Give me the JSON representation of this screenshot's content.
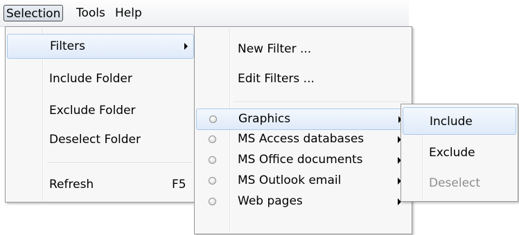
{
  "menubar": {
    "items": [
      {
        "label": "Selection"
      },
      {
        "label": "Tools"
      },
      {
        "label": "Help"
      }
    ]
  },
  "selection_menu": {
    "items": [
      {
        "label": "Filters"
      },
      {
        "label": "Include Folder"
      },
      {
        "label": "Exclude Folder"
      },
      {
        "label": "Deselect Folder"
      },
      {
        "label": "Refresh",
        "shortcut": "F5"
      }
    ]
  },
  "filters_menu": {
    "items": [
      {
        "label": "New Filter ..."
      },
      {
        "label": "Edit Filters ..."
      },
      {
        "label": "Graphics"
      },
      {
        "label": "MS Access databases"
      },
      {
        "label": "MS Office documents"
      },
      {
        "label": "MS Outlook email"
      },
      {
        "label": "Web pages"
      }
    ]
  },
  "graphics_menu": {
    "items": [
      {
        "label": "Include"
      },
      {
        "label": "Exclude"
      },
      {
        "label": "Deselect",
        "disabled": true
      }
    ]
  },
  "colors": {
    "highlight_border": "#a8c8ed",
    "highlight_fill": "#dfeaf9",
    "menu_background": "#f7f7f7",
    "disabled_text": "#8d8d8d"
  }
}
